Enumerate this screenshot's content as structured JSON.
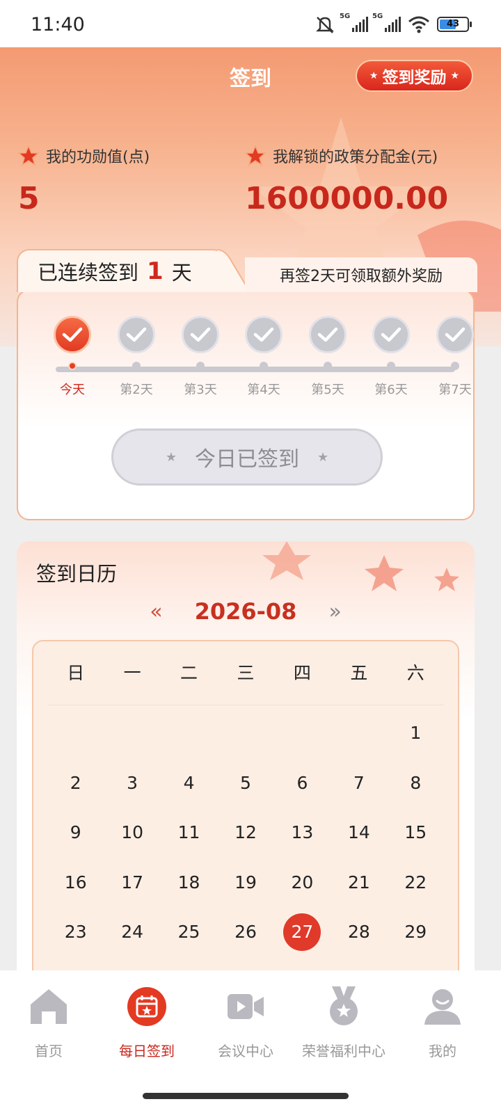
{
  "status_bar": {
    "time": "11:40",
    "network_1": "5G",
    "network_2": "5G",
    "battery": "43"
  },
  "header": {
    "title": "签到",
    "reward_button": "签到奖励",
    "merit": {
      "label": "我的功勋值(点)",
      "value": "5"
    },
    "fund": {
      "label": "我解锁的政策分配金(元)",
      "value": "1600000.00"
    }
  },
  "checkin": {
    "streak_prefix": "已连续签到",
    "streak_days": "1",
    "streak_suffix": "天",
    "tip": "再签2天可领取额外奖励",
    "days": [
      "今天",
      "第2天",
      "第3天",
      "第4天",
      "第5天",
      "第6天",
      "第7天"
    ],
    "button_label": "今日已签到"
  },
  "calendar": {
    "title": "签到日历",
    "prev_symbol": "«",
    "next_symbol": "»",
    "month": "2026-08",
    "weekdays": [
      "日",
      "一",
      "二",
      "三",
      "四",
      "五",
      "六"
    ],
    "first_weekday_index": 6,
    "visible_dates": [
      "1",
      "2",
      "3",
      "4",
      "5",
      "6",
      "7",
      "8",
      "9",
      "10",
      "11",
      "12",
      "13",
      "14",
      "15",
      "16",
      "17",
      "18",
      "19",
      "20",
      "21",
      "22",
      "23",
      "24",
      "25",
      "26",
      "27",
      "28",
      "29"
    ],
    "today": "27"
  },
  "bottom_nav": [
    {
      "label": "首页",
      "icon": "home-icon",
      "active": false
    },
    {
      "label": "每日签到",
      "icon": "calendar-icon",
      "active": true
    },
    {
      "label": "会议中心",
      "icon": "video-camera-icon",
      "active": false
    },
    {
      "label": "荣誉福利中心",
      "icon": "medal-icon",
      "active": false
    },
    {
      "label": "我的",
      "icon": "user-icon",
      "active": false
    }
  ],
  "colors": {
    "accent_red": "#c8281c",
    "header_orange": "#f49a72",
    "inactive_gray": "#999999"
  }
}
